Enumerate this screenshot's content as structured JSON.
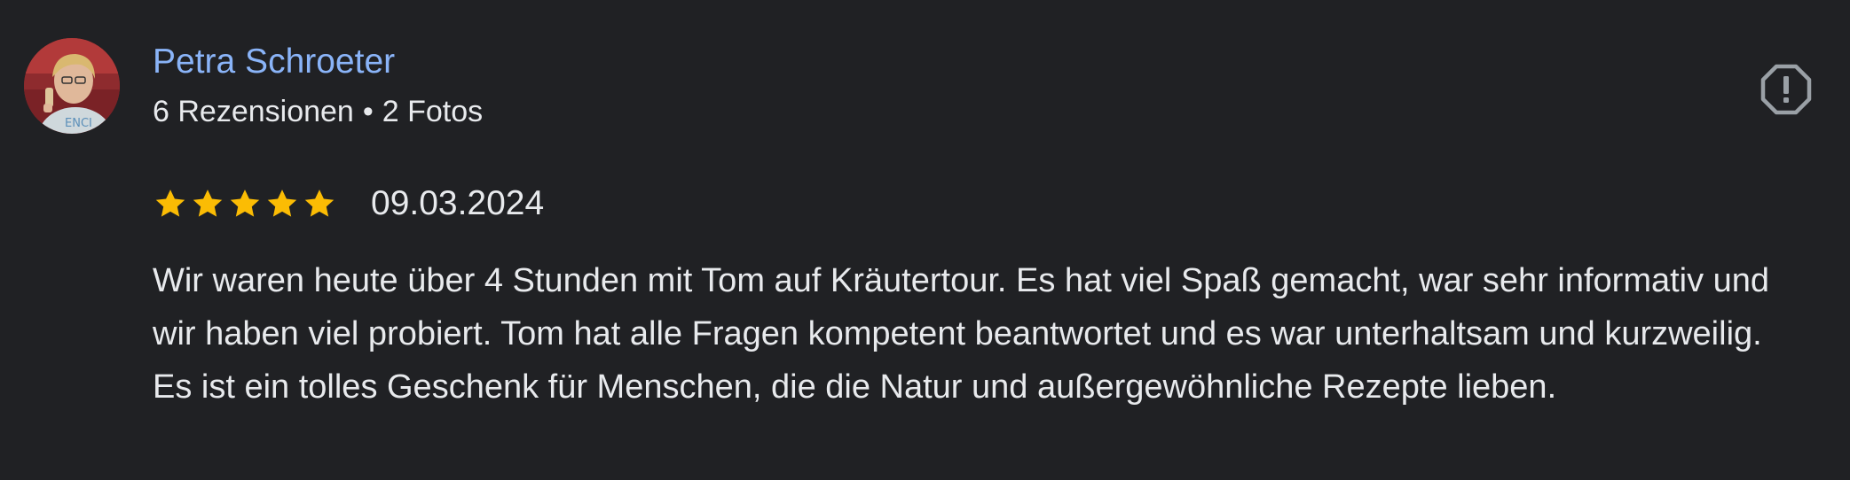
{
  "review": {
    "author": {
      "name": "Petra Schroeter",
      "reviews_count": "6 Rezensionen",
      "separator": "•",
      "photos_count": "2 Fotos",
      "avatar_icon": "profile-photo"
    },
    "rating": {
      "stars": 5,
      "max": 5,
      "star_color": "#fbbc04"
    },
    "date": "09.03.2024",
    "text": "Wir waren heute über 4 Stunden mit Tom auf Kräutertour. Es hat viel Spaß gemacht, war sehr informativ und wir haben viel probiert. Tom hat alle Fragen kompetent beantwortet und es war unterhaltsam und kurzweilig. Es ist ein tolles Geschenk für Menschen, die die Natur und außergewöhnliche Rezepte lieben.",
    "report_icon": "report-icon"
  },
  "colors": {
    "background": "#202124",
    "name": "#8ab4f8",
    "text": "#e8eaed",
    "icon": "#9aa0a6"
  }
}
